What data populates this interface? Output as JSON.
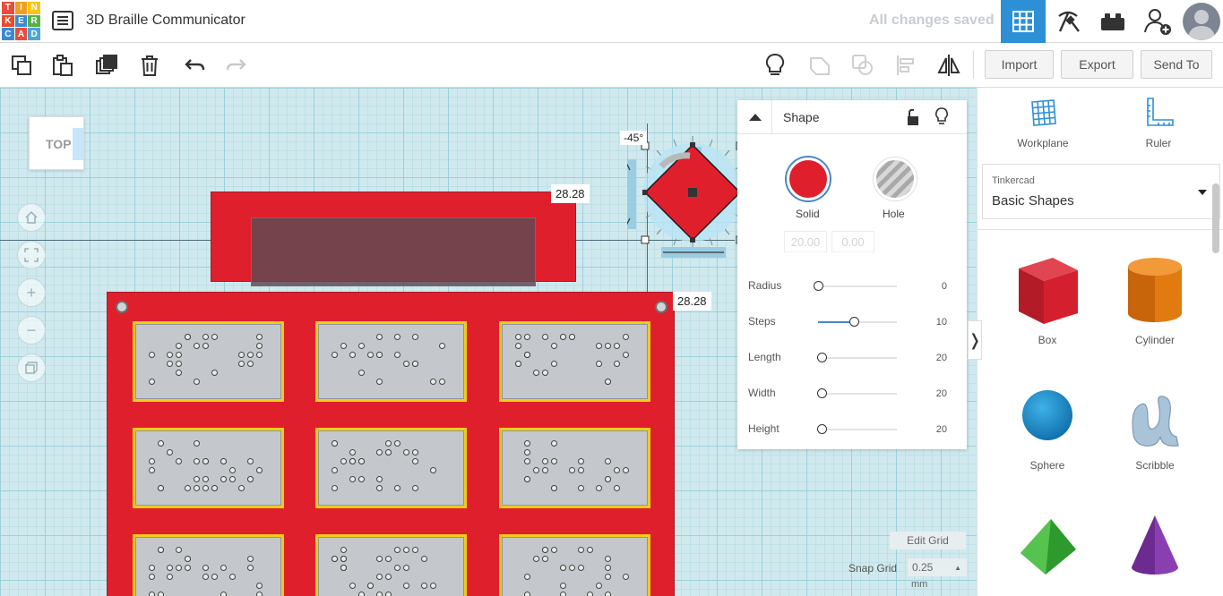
{
  "app": {
    "logo_letters": [
      "T",
      "I",
      "N",
      "K",
      "E",
      "R",
      "C",
      "A",
      "D"
    ],
    "logo_colors": [
      "#e84c3d",
      "#f0a01f",
      "#f7c51a",
      "#ea4b2f",
      "#3a8ad4",
      "#57b246",
      "#3a8ad4",
      "#e84c3d",
      "#4ca5dd"
    ],
    "project_title": "3D Braille Communicator",
    "save_status": "All changes saved",
    "accent_color": "#2d8fd5"
  },
  "toolbar": {
    "import_label": "Import",
    "export_label": "Export",
    "sendto_label": "Send To"
  },
  "workplane": {
    "viewcube_face": "TOP",
    "dimension_width": "28.28",
    "dimension_height": "28.28",
    "rotation_angle": "-45°",
    "edit_grid_label": "Edit Grid",
    "snap_grid_label": "Snap Grid",
    "snap_grid_value": "0.25",
    "snap_grid_unit": "mm",
    "object_color": "#e01f2d",
    "cell_border_color": "#f2cc1c"
  },
  "inspector": {
    "title": "Shape",
    "solid_label": "Solid",
    "hole_label": "Hole",
    "ghost_x": "20.00",
    "ghost_y": "0.00",
    "properties": [
      {
        "label": "Radius",
        "value": "0",
        "fraction": 0.0
      },
      {
        "label": "Steps",
        "value": "10",
        "fraction": 0.45
      },
      {
        "label": "Length",
        "value": "20",
        "fraction": 0.05
      },
      {
        "label": "Width",
        "value": "20",
        "fraction": 0.05
      },
      {
        "label": "Height",
        "value": "20",
        "fraction": 0.05
      }
    ]
  },
  "panel": {
    "workplane_label": "Workplane",
    "ruler_label": "Ruler",
    "library_category": "Tinkercad",
    "library_name": "Basic Shapes",
    "shapes": [
      {
        "label": "Box"
      },
      {
        "label": "Cylinder"
      },
      {
        "label": "Sphere"
      },
      {
        "label": "Scribble"
      }
    ]
  }
}
